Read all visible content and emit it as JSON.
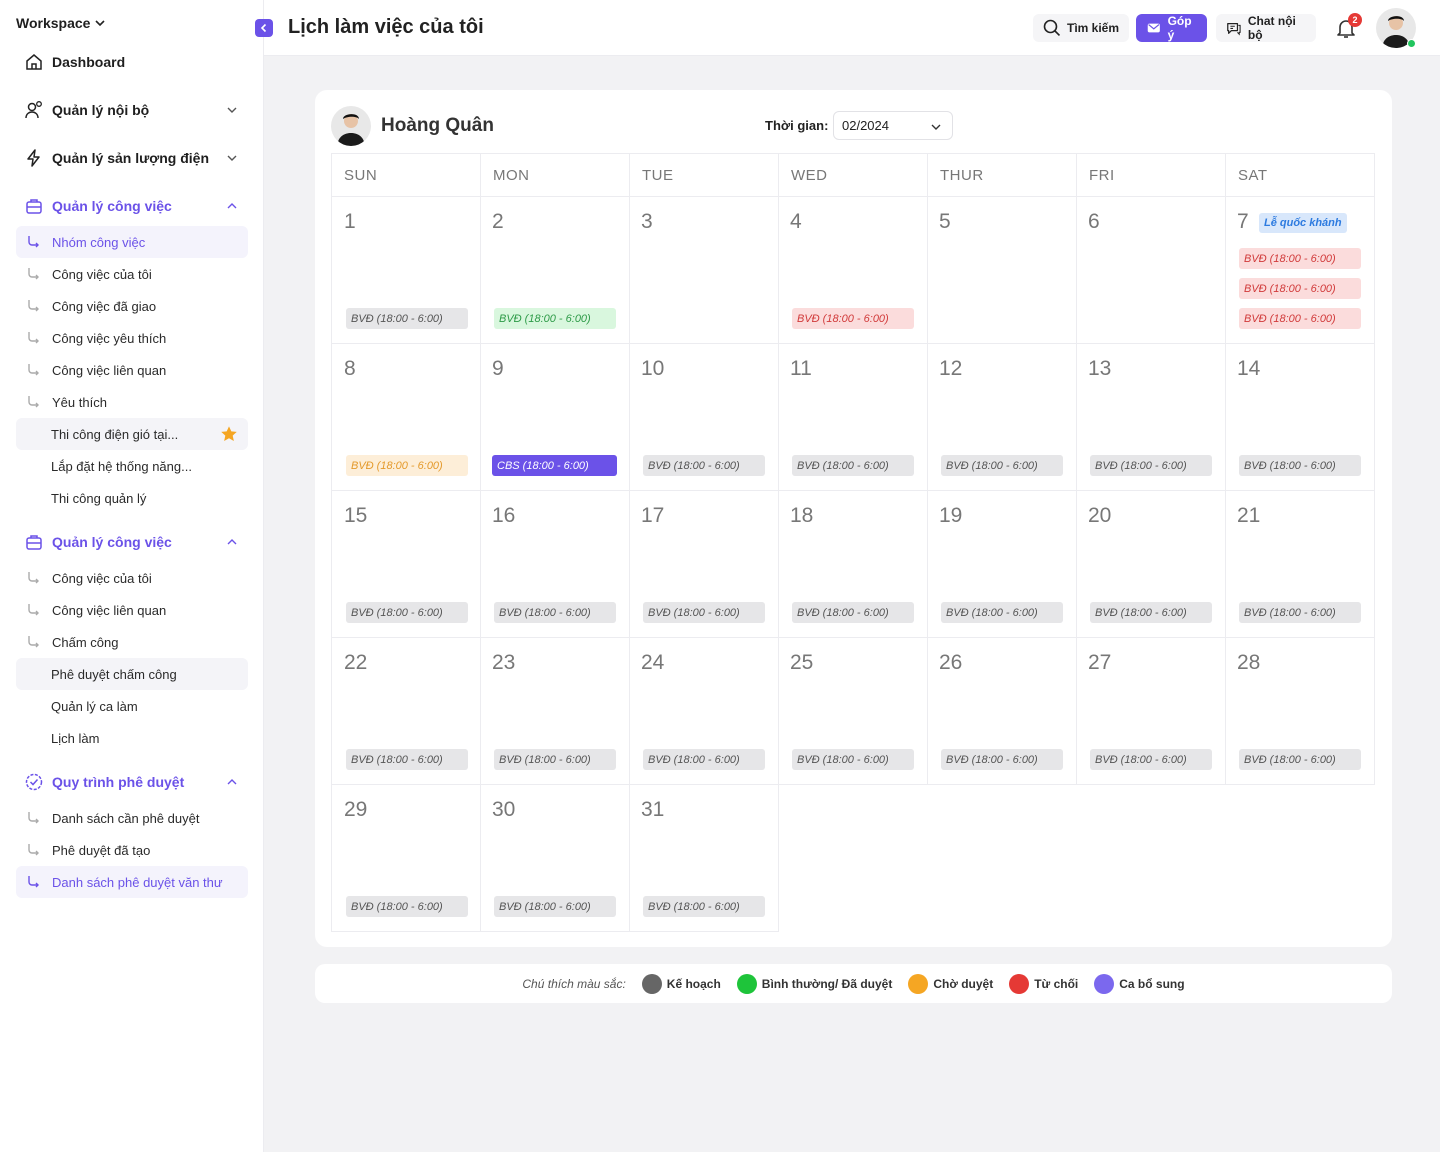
{
  "sidebar": {
    "workspace": "Workspace",
    "dashboard": "Dashboard",
    "internal": "Quản lý nội bộ",
    "power": "Quản lý sản lượng điện",
    "work1": {
      "title": "Quản lý công việc",
      "items": [
        "Nhóm công việc",
        "Công việc của tôi",
        "Công việc đã giao",
        "Công việc yêu thích",
        "Công việc liên quan",
        "Yêu thích"
      ],
      "favorites": [
        "Thi công điện gió tại...",
        "Lắp đặt hệ thống năng...",
        "Thi công quản lý"
      ]
    },
    "work2": {
      "title": "Quản lý công việc",
      "items": [
        "Công việc của tôi",
        "Công việc liên quan",
        "Chấm công"
      ],
      "extra": [
        "Phê duyệt chấm công",
        "Quản lý ca làm",
        "Lịch làm"
      ]
    },
    "approval": {
      "title": "Quy trình phê duyệt",
      "items": [
        "Danh sách cần phê duyệt",
        "Phê duyệt đã tạo",
        "Danh sách phê duyệt văn thư"
      ]
    }
  },
  "topbar": {
    "title": "Lịch làm việc của tôi",
    "search": "Tìm kiếm",
    "feedback": "Góp ý",
    "chat": "Chat nội bộ",
    "notifications": "2"
  },
  "calendar": {
    "user": "Hoàng Quân",
    "time_label": "Thời gian:",
    "month": "02/2024",
    "weekdays": [
      "SUN",
      "MON",
      "TUE",
      "WED",
      "THUR",
      "FRI",
      "SAT"
    ],
    "holiday": "Lễ quốc khánh",
    "days": [
      {
        "d": "1",
        "shifts": [
          {
            "t": "BVĐ (18:00 - 6:00)",
            "s": "plan"
          }
        ]
      },
      {
        "d": "2",
        "shifts": [
          {
            "t": "BVĐ (18:00 - 6:00)",
            "s": "ok"
          }
        ]
      },
      {
        "d": "3",
        "shifts": []
      },
      {
        "d": "4",
        "shifts": [
          {
            "t": "BVĐ (18:00 - 6:00)",
            "s": "rej"
          }
        ]
      },
      {
        "d": "5",
        "shifts": []
      },
      {
        "d": "6",
        "shifts": []
      },
      {
        "d": "7",
        "shifts": [
          {
            "t": "BVĐ (18:00 - 6:00)",
            "s": "rej"
          },
          {
            "t": "BVĐ (18:00 - 6:00)",
            "s": "rej"
          },
          {
            "t": "BVĐ (18:00 - 6:00)",
            "s": "rej"
          }
        ]
      },
      {
        "d": "8",
        "shifts": [
          {
            "t": "BVĐ (18:00 - 6:00)",
            "s": "wait"
          }
        ]
      },
      {
        "d": "9",
        "shifts": [
          {
            "t": "CBS (18:00 - 6:00)",
            "s": "add"
          }
        ]
      },
      {
        "d": "10",
        "shifts": [
          {
            "t": "BVĐ (18:00 - 6:00)",
            "s": "plan"
          }
        ]
      },
      {
        "d": "11",
        "shifts": [
          {
            "t": "BVĐ (18:00 - 6:00)",
            "s": "plan"
          }
        ]
      },
      {
        "d": "12",
        "shifts": [
          {
            "t": "BVĐ (18:00 - 6:00)",
            "s": "plan"
          }
        ]
      },
      {
        "d": "13",
        "shifts": [
          {
            "t": "BVĐ (18:00 - 6:00)",
            "s": "plan"
          }
        ]
      },
      {
        "d": "14",
        "shifts": [
          {
            "t": "BVĐ (18:00 - 6:00)",
            "s": "plan"
          }
        ]
      },
      {
        "d": "15",
        "shifts": [
          {
            "t": "BVĐ (18:00 - 6:00)",
            "s": "plan"
          }
        ]
      },
      {
        "d": "16",
        "shifts": [
          {
            "t": "BVĐ (18:00 - 6:00)",
            "s": "plan"
          }
        ]
      },
      {
        "d": "17",
        "shifts": [
          {
            "t": "BVĐ (18:00 - 6:00)",
            "s": "plan"
          }
        ]
      },
      {
        "d": "18",
        "shifts": [
          {
            "t": "BVĐ (18:00 - 6:00)",
            "s": "plan"
          }
        ]
      },
      {
        "d": "19",
        "shifts": [
          {
            "t": "BVĐ (18:00 - 6:00)",
            "s": "plan"
          }
        ]
      },
      {
        "d": "20",
        "shifts": [
          {
            "t": "BVĐ (18:00 - 6:00)",
            "s": "plan"
          }
        ]
      },
      {
        "d": "21",
        "shifts": [
          {
            "t": "BVĐ (18:00 - 6:00)",
            "s": "plan"
          }
        ]
      },
      {
        "d": "22",
        "shifts": [
          {
            "t": "BVĐ (18:00 - 6:00)",
            "s": "plan"
          }
        ]
      },
      {
        "d": "23",
        "shifts": [
          {
            "t": "BVĐ (18:00 - 6:00)",
            "s": "plan"
          }
        ]
      },
      {
        "d": "24",
        "shifts": [
          {
            "t": "BVĐ (18:00 - 6:00)",
            "s": "plan"
          }
        ]
      },
      {
        "d": "25",
        "shifts": [
          {
            "t": "BVĐ (18:00 - 6:00)",
            "s": "plan"
          }
        ]
      },
      {
        "d": "26",
        "shifts": [
          {
            "t": "BVĐ (18:00 - 6:00)",
            "s": "plan"
          }
        ]
      },
      {
        "d": "27",
        "shifts": [
          {
            "t": "BVĐ (18:00 - 6:00)",
            "s": "plan"
          }
        ]
      },
      {
        "d": "28",
        "shifts": [
          {
            "t": "BVĐ (18:00 - 6:00)",
            "s": "plan"
          }
        ]
      },
      {
        "d": "29",
        "shifts": [
          {
            "t": "BVĐ (18:00 - 6:00)",
            "s": "plan"
          }
        ]
      },
      {
        "d": "30",
        "shifts": [
          {
            "t": "BVĐ (18:00 - 6:00)",
            "s": "plan"
          }
        ]
      },
      {
        "d": "31",
        "shifts": [
          {
            "t": "BVĐ (18:00 - 6:00)",
            "s": "plan"
          }
        ]
      }
    ]
  },
  "legend": {
    "title": "Chú thích màu sắc:",
    "items": [
      {
        "label": "Kế hoạch",
        "color": "#666666"
      },
      {
        "label": "Bình thường/ Đã duyệt",
        "color": "#1ec43a"
      },
      {
        "label": "Chờ duyệt",
        "color": "#f5a623"
      },
      {
        "label": "Từ chối",
        "color": "#e53935"
      },
      {
        "label": "Ca bổ sung",
        "color": "#7b68ee"
      }
    ]
  },
  "colors": {
    "accent": "#6b52e8"
  }
}
